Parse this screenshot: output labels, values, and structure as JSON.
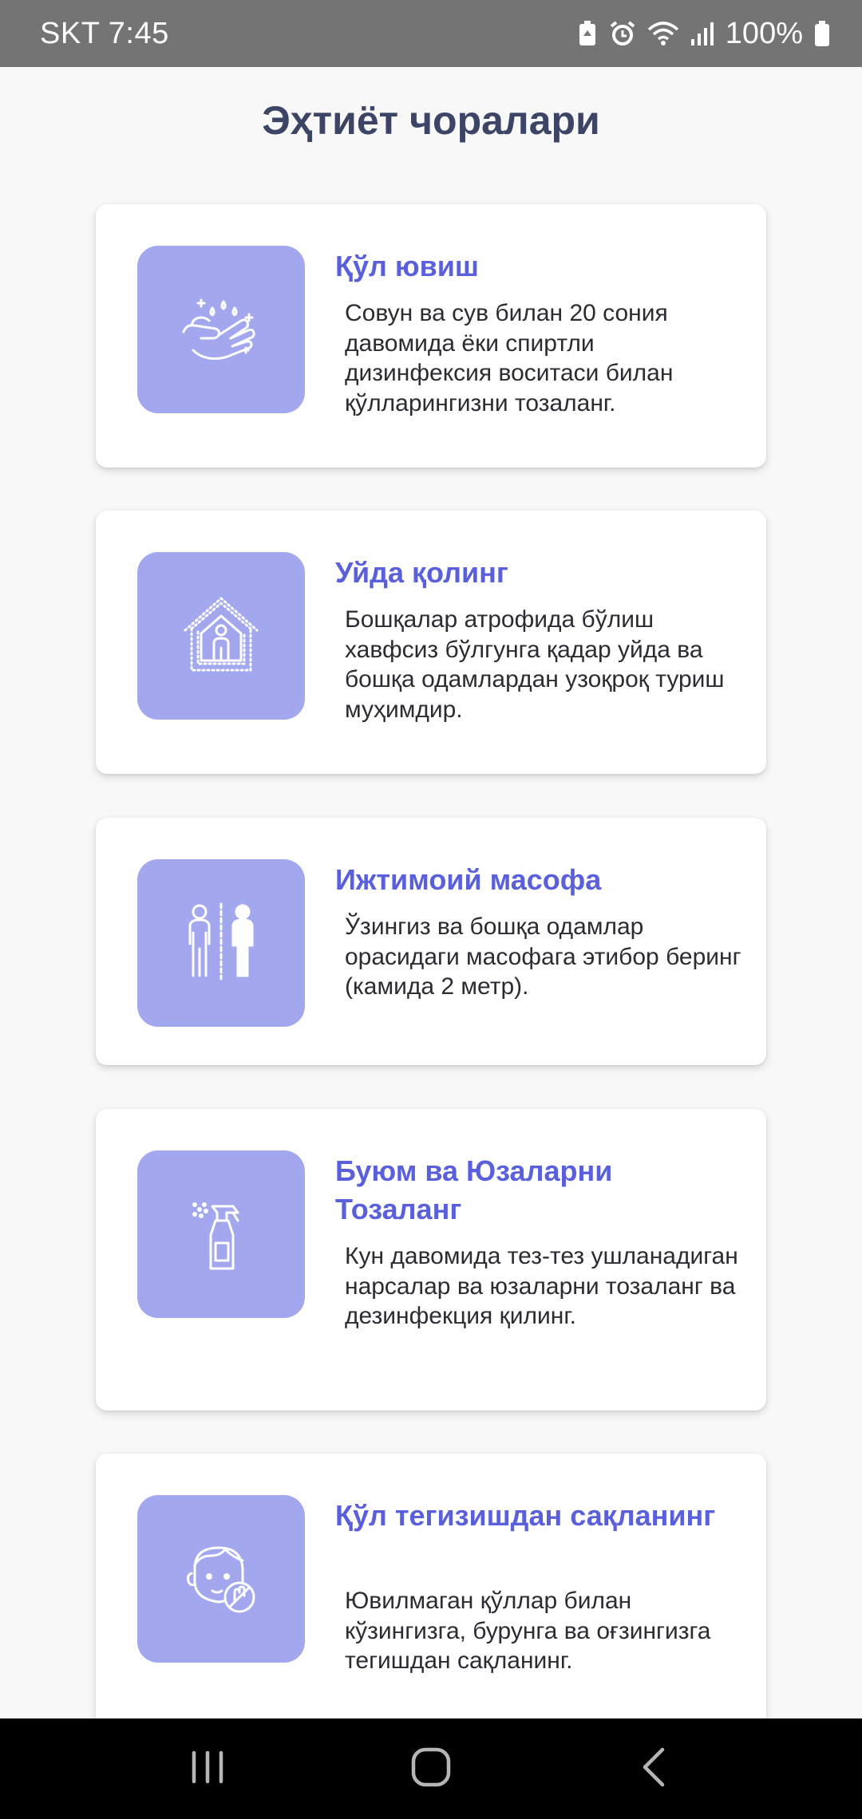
{
  "status_bar": {
    "carrier_time": "SKT 7:45",
    "battery_percent": "100%",
    "icons": [
      "battery-saver-icon",
      "alarm-icon",
      "wifi-icon",
      "signal-icon",
      "battery-icon"
    ]
  },
  "header": {
    "title": "Эҳтиёт чоралари"
  },
  "cards": [
    {
      "icon": "hand-washing-icon",
      "title": "Қўл ювиш",
      "text": "Совун ва сув билан 20 сония давомида ёки спиртли дизинфексия воситаси билан қўлларингизни тозаланг."
    },
    {
      "icon": "stay-home-icon",
      "title": "Уйда қолинг",
      "text": "Бошқалар атрофида бўлиш хавфсиз бўлгунга қадар уйда ва бошқа одамлардан узоқроқ туриш муҳимдир."
    },
    {
      "icon": "social-distance-icon",
      "title": "Ижтимоий масофа",
      "text": "Ўзингиз ва бошқа одамлар орасидаги масофага этибор беринг (камида 2 метр)."
    },
    {
      "icon": "spray-bottle-icon",
      "title": "Буюм ва Юзаларни Тозаланг",
      "text": "Кун давомида тез-тез ушланадиган нарсалар ва юзаларни тозаланг ва дезинфекция қилинг."
    },
    {
      "icon": "no-face-touch-icon",
      "title": "Қўл тегизишдан сақланинг",
      "text": "Ювилмаган қўллар билан кўзингизга, бурунга ва оғзингизга тегишдан сақланинг."
    }
  ],
  "nav_bar": {
    "buttons": [
      "recent-apps-icon",
      "home-icon",
      "back-icon"
    ]
  },
  "colors": {
    "status_bar_bg": "#747474",
    "title_color": "#3d4566",
    "card_title_color": "#5a5fdc",
    "icon_tile_bg": "#a3a7ed",
    "nav_bar_bg": "#000000"
  }
}
